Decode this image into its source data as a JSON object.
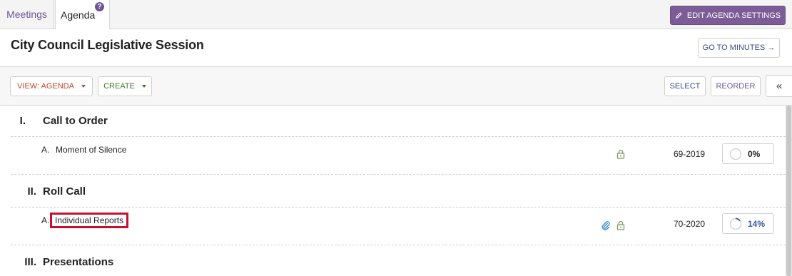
{
  "tabs": {
    "meetings": "Meetings",
    "agenda": "Agenda",
    "help": "?"
  },
  "header": {
    "edit_settings": "EDIT AGENDA SETTINGS",
    "title": "City Council Legislative Session",
    "goto_minutes": "GO TO MINUTES →"
  },
  "toolbar": {
    "view": "VIEW: AGENDA",
    "create": "CREATE",
    "select": "SELECT",
    "reorder": "REORDER",
    "collapse": "«"
  },
  "sections": [
    {
      "num": "I.",
      "title": "Call to Order",
      "items": [
        {
          "letter": "A.",
          "title": "Moment of Silence",
          "code": "69-2019",
          "progress": "0%",
          "progress_value": 0,
          "attachment": false,
          "locked": true
        }
      ]
    },
    {
      "num": "II.",
      "title": "Roll Call",
      "items": [
        {
          "letter": "A.",
          "title": "Individual Reports",
          "code": "70-2020",
          "progress": "14%",
          "progress_value": 14,
          "attachment": true,
          "locked": true
        }
      ]
    },
    {
      "num": "III.",
      "title": "Presentations",
      "items": []
    }
  ],
  "colors": {
    "purple": "#7b5c96",
    "lock": "#7a9a5a",
    "clip": "#3b8fd6",
    "progress_blue": "#3a56a6",
    "highlight": "#c8102e"
  }
}
